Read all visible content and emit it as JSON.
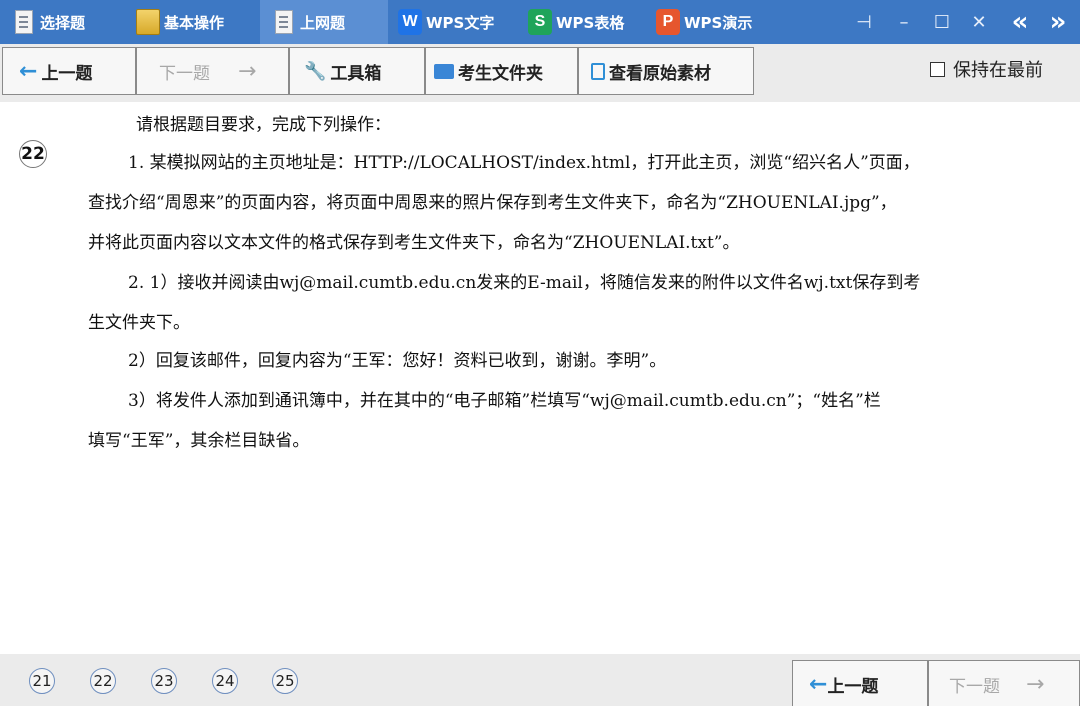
{
  "tabs": [
    {
      "label": "选择题",
      "icon": "doc-icon"
    },
    {
      "label": "基本操作",
      "icon": "folder-icon"
    },
    {
      "label": "上网题",
      "icon": "doc-icon"
    },
    {
      "label": "WPS文字",
      "icon": "wps-writer-icon",
      "glyph": "W"
    },
    {
      "label": "WPS表格",
      "icon": "wps-spreadsheet-icon",
      "glyph": "S"
    },
    {
      "label": "WPS演示",
      "icon": "wps-presentation-icon",
      "glyph": "P"
    }
  ],
  "window_controls": {
    "pin": "⊣",
    "minimize": "–",
    "maximize": "☐",
    "close": "✕",
    "prev": "«",
    "next": "»"
  },
  "toolbar": {
    "prev_label": "上一题",
    "next_label": "下一题",
    "toolbox_label": "工具箱",
    "student_folder_label": "考生文件夹",
    "original_material_label": "查看原始素材",
    "keep_on_top_label": "保持在最前"
  },
  "question": {
    "number": "22",
    "lines": [
      "请根据题目要求，完成下列操作：",
      "1. 某模拟网站的主页地址是：HTTP://LOCALHOST/index.html，打开此主页，浏览“绍兴名人”页面，",
      "查找介绍“周恩来”的页面内容，将页面中周恩来的照片保存到考生文件夹下，命名为“ZHOUENLAI.jpg”，",
      "并将此页面内容以文本文件的格式保存到考生文件夹下，命名为“ZHOUENLAI.txt”。",
      "2. 1）接收并阅读由wj@mail.cumtb.edu.cn发来的E-mail，将随信发来的附件以文件名wj.txt保存到考",
      "生文件夹下。",
      "2）回复该邮件，回复内容为“王军：您好！资料已收到，谢谢。李明”。",
      "3）将发件人添加到通讯簿中，并在其中的“电子邮箱”栏填写“wj@mail.cumtb.edu.cn”；“姓名”栏",
      "填写“王军”，其余栏目缺省。"
    ]
  },
  "bottom_nav": {
    "numbers": [
      "21",
      "22",
      "23",
      "24",
      "25"
    ],
    "prev_label": "上一题",
    "next_label": "下一题"
  },
  "colors": {
    "tab_bar": "#3d78c4",
    "active_tab": "#5b8fd3",
    "toolbar": "#ebebeb",
    "arrow": "#2f8fd6"
  }
}
